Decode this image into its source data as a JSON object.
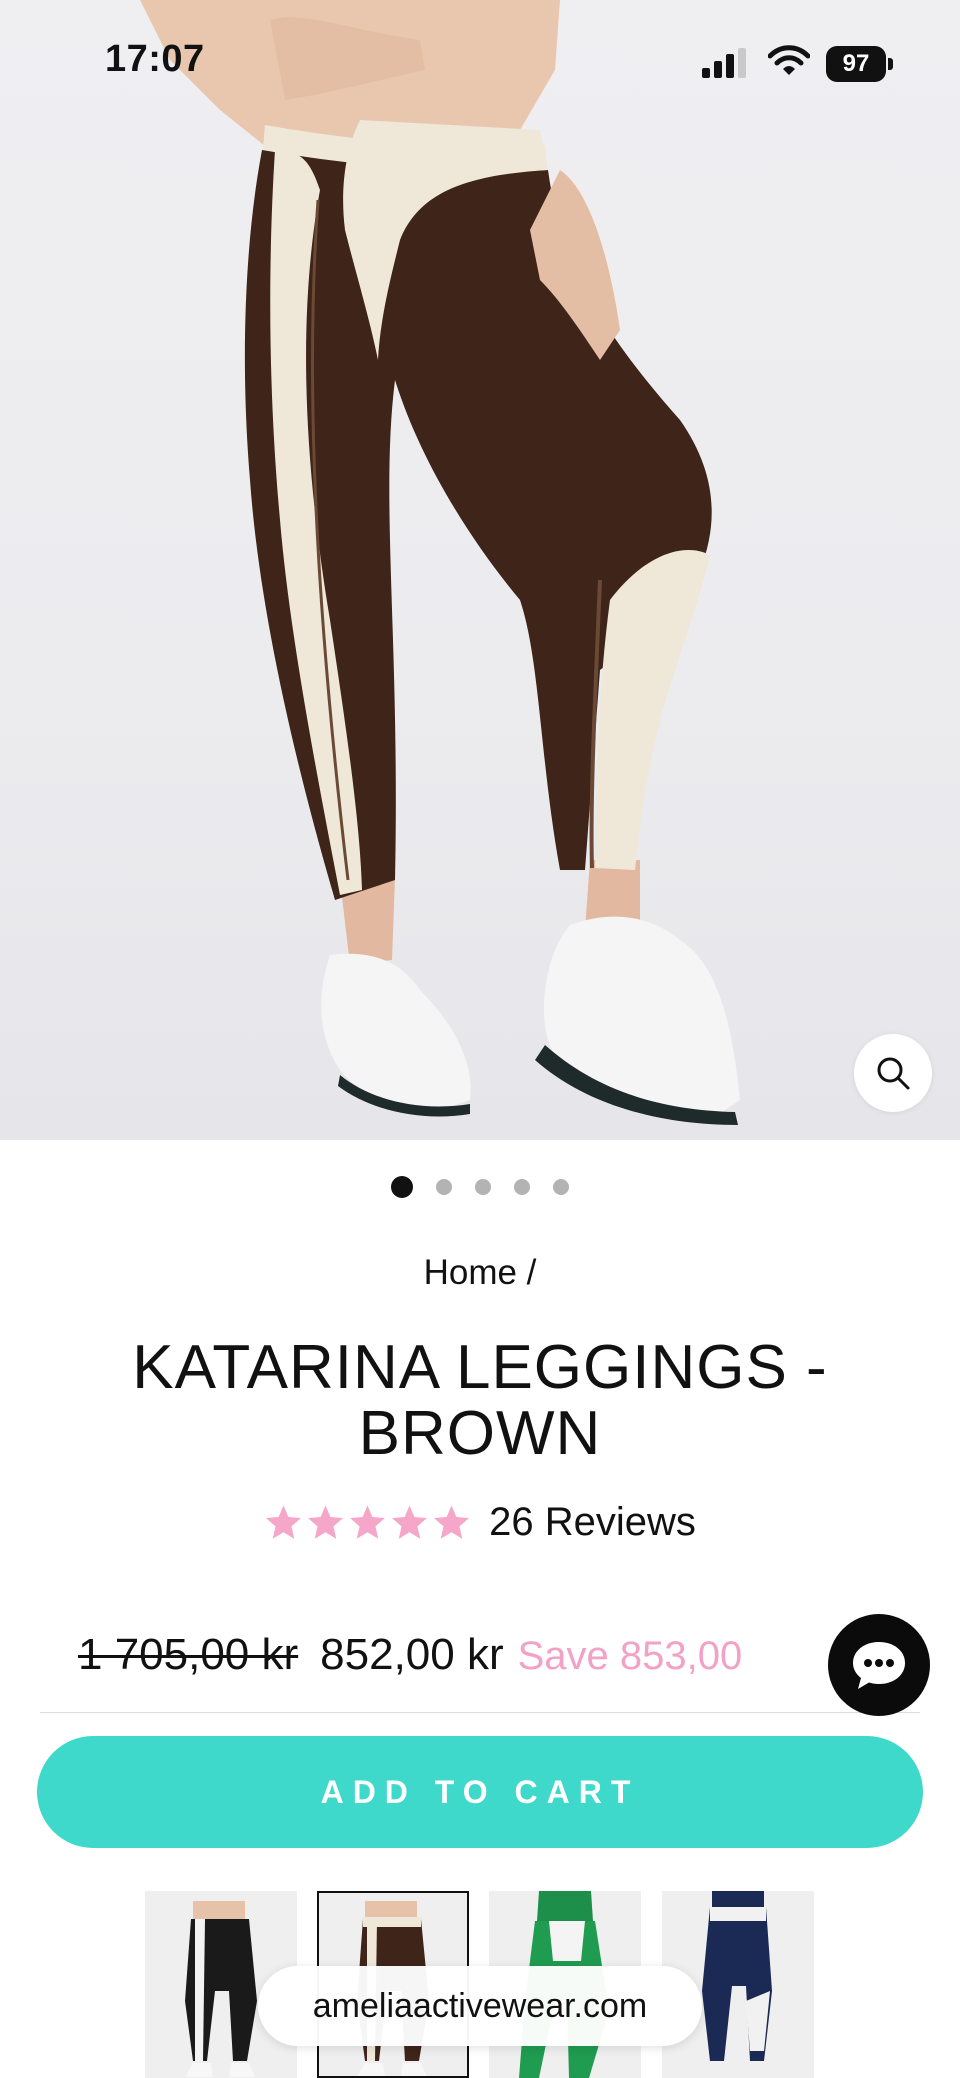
{
  "status_bar": {
    "time": "17:07",
    "battery": "97",
    "icons": [
      "signal-icon",
      "wifi-icon",
      "battery-icon"
    ]
  },
  "hero": {
    "image": "product-photo-leggings",
    "zoom_icon": "search-icon"
  },
  "carousel": {
    "total": 5,
    "active": 1
  },
  "breadcrumb": {
    "text": "Home /"
  },
  "product": {
    "title": "KATARINA LEGGINGS - BROWN",
    "rating": 5,
    "reviews_label": "26 Reviews",
    "old_price": "1 705,00 kr",
    "price": "852,00 kr",
    "save_label": "Save 853,00"
  },
  "actions": {
    "add_to_cart": "ADD TO CART",
    "chat_icon": "chat-bubble-icon"
  },
  "variants": [
    {
      "name": "black",
      "selected": false
    },
    {
      "name": "brown",
      "selected": true
    },
    {
      "name": "green",
      "selected": false
    },
    {
      "name": "navy",
      "selected": false
    }
  ],
  "browser": {
    "url": "ameliaactivewear.com"
  },
  "colors": {
    "accent": "#3ed9cb",
    "star": "#f5a6c9",
    "save": "#f2a2c6",
    "legging_brown": "#3e2419",
    "legging_cream": "#efe8d8"
  }
}
